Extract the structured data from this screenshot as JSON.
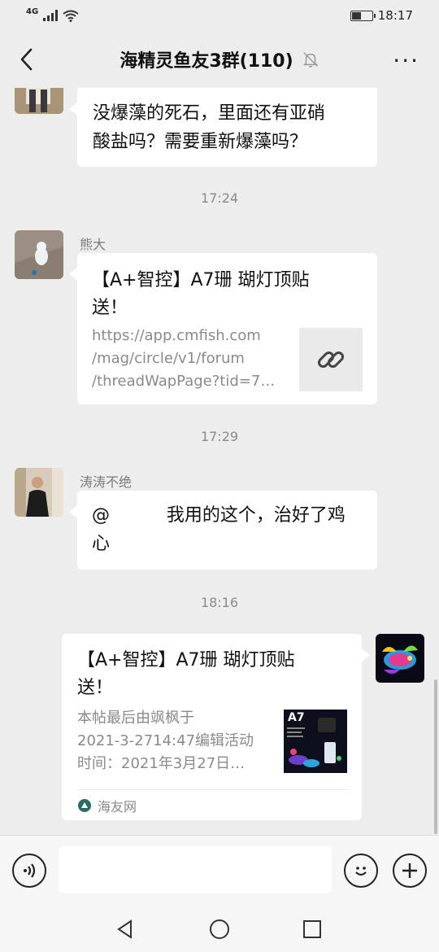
{
  "status_bar": {
    "network": "4G",
    "time": "18:17",
    "battery_level": 0.45
  },
  "header": {
    "title": "海精灵鱼友3群(110)"
  },
  "messages": [
    {
      "text_line1": "没爆藻的死石，里面还有亚硝",
      "text_line2": "酸盐吗？需要重新爆藻吗？"
    },
    {
      "time": "17:24"
    },
    {
      "sender": "熊大",
      "link_title_line1": "【A+智控】A7珊 瑚灯顶贴",
      "link_title_line2": "送！",
      "link_desc_line1": "https://app.cmfish.com",
      "link_desc_line2": "/mag/circle/v1/forum",
      "link_desc_line3": "/threadWapPage?tid=7…"
    },
    {
      "time": "17:29"
    },
    {
      "sender": "涛涛不绝",
      "text_line1": "@          我用的这个，治好了鸡",
      "text_line2": "心"
    },
    {
      "time": "18:16"
    },
    {
      "link_title_line1": "【A+智控】A7珊 瑚灯顶贴",
      "link_title_line2": "送！",
      "link_desc_line1": "本帖最后由飒枫于",
      "link_desc_line2": "2021-3-2714:47编辑活动",
      "link_desc_line3": "时间：2021年3月27日…",
      "thumb_label": "A7",
      "source": "海友网"
    }
  ],
  "input": {
    "placeholder": ""
  }
}
